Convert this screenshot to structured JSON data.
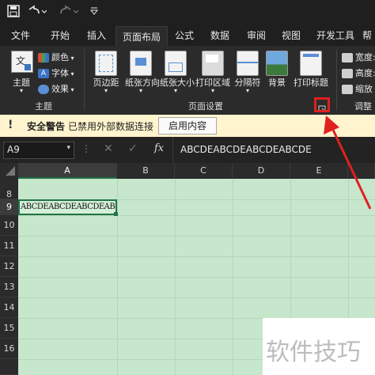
{
  "qat": {
    "save_icon": "save-icon",
    "undo_icon": "undo-icon",
    "redo_icon": "redo-icon",
    "customize_icon": "customize-icon"
  },
  "tabs": [
    "文件",
    "开始",
    "插入",
    "页面布局",
    "公式",
    "数据",
    "审阅",
    "视图",
    "开发工具",
    "帮"
  ],
  "active_tab": "页面布局",
  "ribbon": {
    "theme": {
      "label": "主题",
      "colors": "颜色",
      "fonts": "字体",
      "effects": "效果",
      "icon_text": "文"
    },
    "group_theme": "主题",
    "page_setup_buttons": [
      "页边距",
      "纸张方向",
      "纸张大小",
      "打印区域",
      "分隔符",
      "背景",
      "打印标题"
    ],
    "group_page_setup": "页面设置",
    "scale": {
      "width": "宽度:",
      "height": "高度:",
      "scale": "缩放"
    },
    "group_scale": "调整",
    "dialog_launcher_icon": "dialog-launcher-icon"
  },
  "security_bar": {
    "title": "安全警告",
    "message": "已禁用外部数据连接",
    "button": "启用内容"
  },
  "formula_bar": {
    "name_box": "A9",
    "fx": "fx",
    "formula": "ABCDEABCDEABCDEABCDE"
  },
  "sheet": {
    "columns": [
      "A",
      "B",
      "C",
      "D",
      "E"
    ],
    "rows": [
      "8",
      "9",
      "10",
      "11",
      "12",
      "13",
      "14",
      "15",
      "16"
    ],
    "selected_cell": "A9",
    "cell_a9": "ABCDEABCDEABCDEABCDE",
    "grid_color": "#c6e7cc"
  },
  "watermark": "软件技巧",
  "colors": {
    "accent_red": "#e02020",
    "security_bg": "#fff4ce",
    "selection": "#217346"
  }
}
